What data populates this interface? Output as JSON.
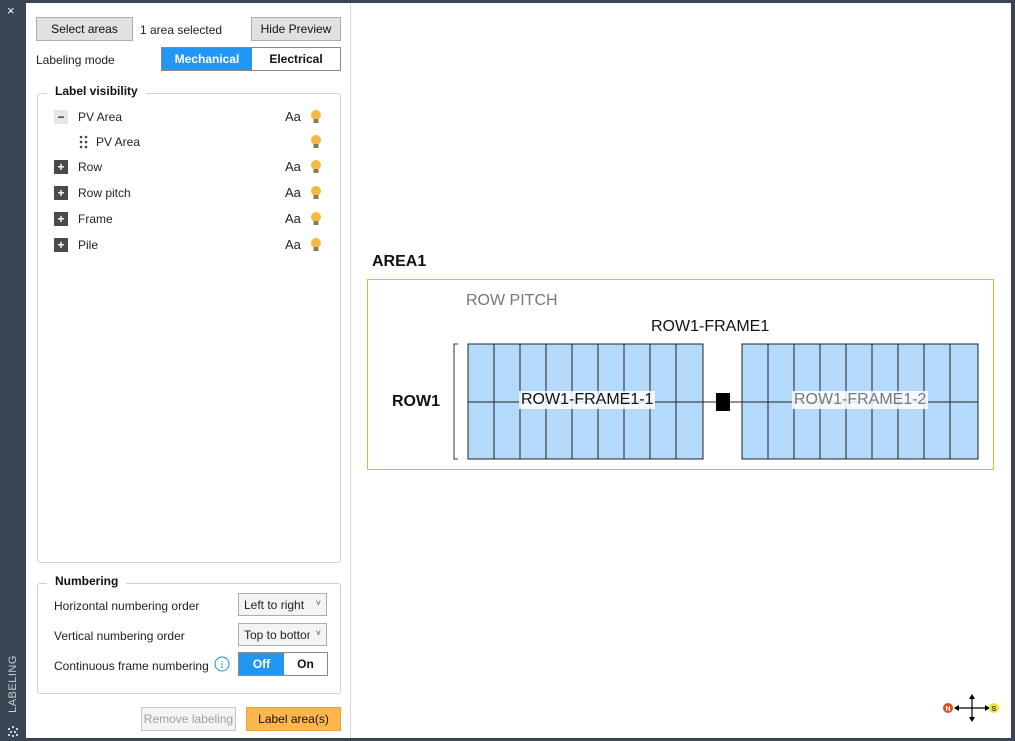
{
  "sidebar": {
    "close_glyph": "×",
    "vertical_label": "LABELING"
  },
  "toolbar": {
    "select_areas": "Select areas",
    "selection_count": "1 area selected",
    "hide_preview": "Hide Preview"
  },
  "labeling_mode": {
    "label": "Labeling mode",
    "options": [
      "Mechanical",
      "Electrical"
    ],
    "selected": "Mechanical"
  },
  "label_visibility": {
    "title": "Label visibility",
    "items": [
      {
        "label": "PV Area",
        "expanded": true,
        "aa": "Aa",
        "icon": "bulb-icon"
      },
      {
        "label": "PV Area",
        "child": true,
        "icon": "bulb-icon"
      },
      {
        "label": "Row",
        "aa": "Aa",
        "icon": "bulb-icon"
      },
      {
        "label": "Row pitch",
        "aa": "Aa",
        "icon": "bulb-icon"
      },
      {
        "label": "Frame",
        "aa": "Aa",
        "icon": "bulb-icon"
      },
      {
        "label": "Pile",
        "aa": "Aa",
        "icon": "bulb-icon"
      }
    ]
  },
  "numbering": {
    "title": "Numbering",
    "horizontal_label": "Horizontal numbering order",
    "horizontal_value": "Left to right",
    "vertical_label": "Vertical numbering order",
    "vertical_value": "Top to bottom",
    "continuous_label": "Continuous frame numbering",
    "continuous_options": [
      "Off",
      "On"
    ],
    "continuous_selected": "Off"
  },
  "footer": {
    "remove": "Remove labeling",
    "label_areas": "Label area(s)"
  },
  "preview": {
    "area_label": "AREA1",
    "row_pitch": "ROW PITCH",
    "row_frame_title": "ROW1-FRAME1",
    "row_label": "ROW1",
    "frame1": "ROW1-FRAME1-1",
    "frame2": "ROW1-FRAME1-2",
    "compass": {
      "n": "N",
      "s": "S"
    }
  },
  "colors": {
    "accent": "#2196f3",
    "primary_action": "#ffb74d",
    "area_border": "#f2b233",
    "panel_fill": "#b3d9fb"
  }
}
